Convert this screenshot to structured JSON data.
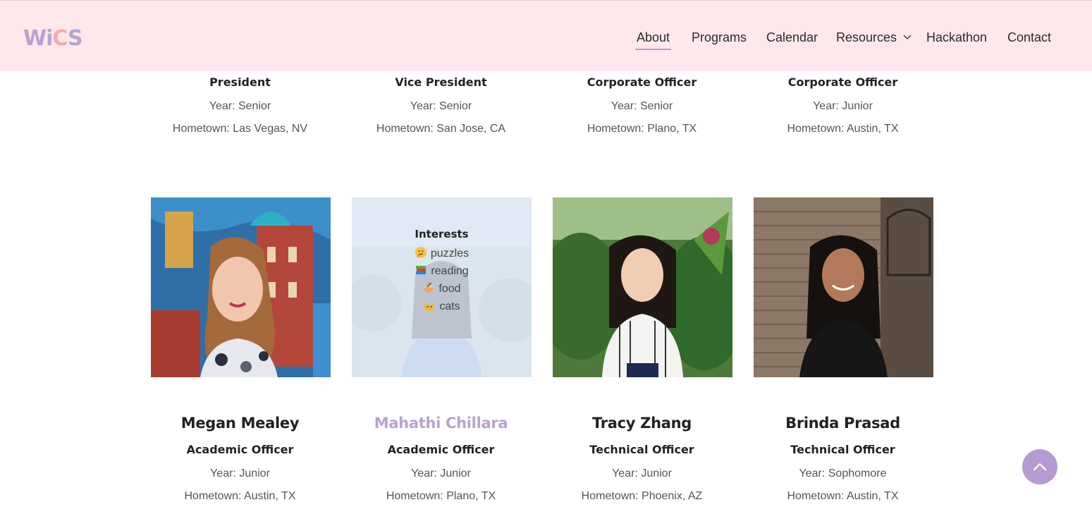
{
  "logo": {
    "part1": "Wi",
    "part2": "C",
    "part3": "S"
  },
  "nav": {
    "items": [
      {
        "label": "About",
        "active": true
      },
      {
        "label": "Programs"
      },
      {
        "label": "Calendar"
      },
      {
        "label": "Resources"
      },
      {
        "label": "Hackathon"
      },
      {
        "label": "Contact"
      }
    ]
  },
  "top_members": [
    {
      "role": "President",
      "year": "Year: Senior",
      "hometown": "Hometown: Las Vegas, NV"
    },
    {
      "role": "Vice President",
      "year": "Year: Senior",
      "hometown": "Hometown: San Jose, CA"
    },
    {
      "role": "Corporate Officer",
      "year": "Year: Senior",
      "hometown": "Hometown: Plano, TX"
    },
    {
      "role": "Corporate Officer",
      "year": "Year: Junior",
      "hometown": "Hometown: Austin, TX"
    }
  ],
  "members": [
    {
      "name": "Megan Mealey",
      "role": "Academic Officer",
      "year": "Year: Junior",
      "hometown": "Hometown: Austin, TX"
    },
    {
      "name": "Mahathi Chillara",
      "role": "Academic Officer",
      "year": "Year: Junior",
      "hometown": "Hometown: Plano, TX"
    },
    {
      "name": "Tracy Zhang",
      "role": "Technical Officer",
      "year": "Year: Junior",
      "hometown": "Hometown: Phoenix, AZ"
    },
    {
      "name": "Brinda Prasad",
      "role": "Technical Officer",
      "year": "Year: Sophomore",
      "hometown": "Hometown: Austin, TX"
    }
  ],
  "interests_overlay": {
    "title": "Interests",
    "items": [
      {
        "icon": "thinking-face-icon",
        "label": "puzzles"
      },
      {
        "icon": "books-icon",
        "label": "reading"
      },
      {
        "icon": "noodle-bowl-icon",
        "label": "food"
      },
      {
        "icon": "cat-face-icon",
        "label": "cats"
      }
    ]
  },
  "colors": {
    "navbar_bg": "#ffe8ec",
    "accent_purple": "#b69bd0",
    "logo_pink": "#f4a9b6"
  }
}
